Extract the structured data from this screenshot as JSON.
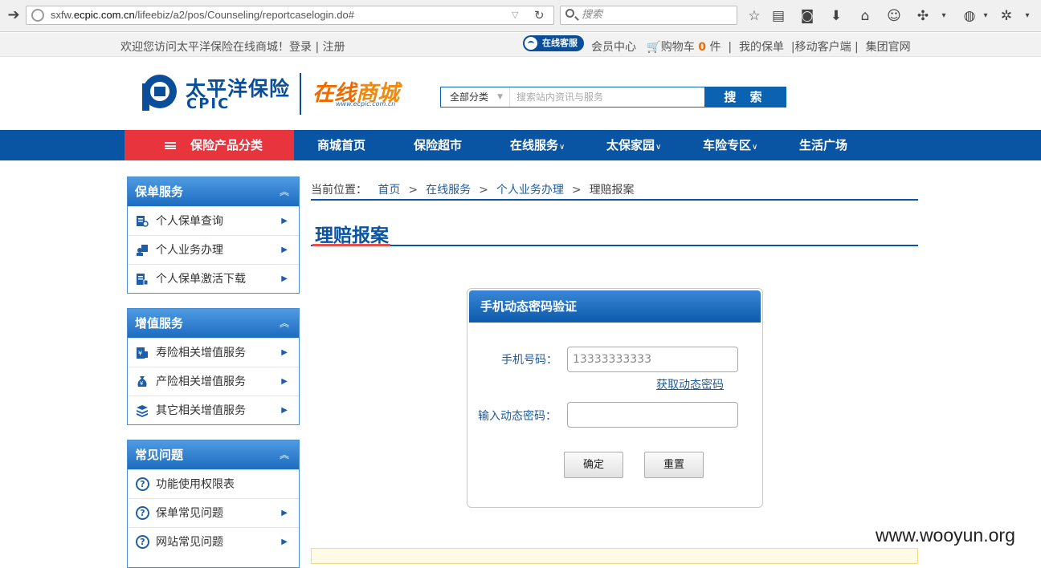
{
  "browser": {
    "url_prefix": "sxfw.",
    "url_host": "ecpic.com.cn",
    "url_path": "/lifeebiz/a2/pos/Counseling/reportcaselogin.do#",
    "search_placeholder": "搜索"
  },
  "topbar": {
    "welcome": "欢迎您访问太平洋保险在线商城！",
    "login": "登录",
    "sep": " | ",
    "register": "注册",
    "kefu": "在线客服",
    "member": "会员中心",
    "cart": "购物车",
    "cart_count": "0",
    "cart_unit": "件",
    "my_policy": "我的保单",
    "mobile": "移动客户端",
    "group": "集团官网"
  },
  "header": {
    "logo_cn": "太平洋保险",
    "logo_en": "CPIC",
    "mall_zai": "在线",
    "mall_rest": "商城",
    "mall_url": "www.ecpic.com.cn",
    "search_category": "全部分类",
    "search_placeholder": "搜索站内资讯与服务",
    "search_button": "搜 索"
  },
  "nav": {
    "category": "保险产品分类",
    "items": [
      {
        "label": "商城首页",
        "dropdown": false
      },
      {
        "label": "保险超市",
        "dropdown": false
      },
      {
        "label": "在线服务",
        "dropdown": true
      },
      {
        "label": "太保家园",
        "dropdown": true
      },
      {
        "label": "车险专区",
        "dropdown": true
      },
      {
        "label": "生活广场",
        "dropdown": false
      }
    ]
  },
  "sidebar": {
    "policy": {
      "title": "保单服务",
      "items": [
        "个人保单查询",
        "个人业务办理",
        "个人保单激活下载"
      ]
    },
    "value": {
      "title": "增值服务",
      "items": [
        "寿险相关增值服务",
        "产险相关增值服务",
        "其它相关增值服务"
      ]
    },
    "faq": {
      "title": "常见问题",
      "items": [
        "功能使用权限表",
        "保单常见问题",
        "网站常见问题"
      ]
    }
  },
  "breadcrumb": {
    "prefix": "当前位置：",
    "items": [
      "首页",
      "在线服务",
      "个人业务办理",
      "理赔报案"
    ]
  },
  "page": {
    "title": "理赔报案"
  },
  "form": {
    "title": "手机动态密码验证",
    "phone_label": "手机号码：",
    "phone_value": "13333333333",
    "get_code": "获取动态密码",
    "code_label": "输入动态密码：",
    "code_value": "",
    "confirm": "确定",
    "reset": "重置"
  },
  "watermark": "www.wooyun.org",
  "colors": {
    "brand_blue": "#0a55a3",
    "nav_red": "#e8343d",
    "accent_orange": "#ee6a00"
  }
}
